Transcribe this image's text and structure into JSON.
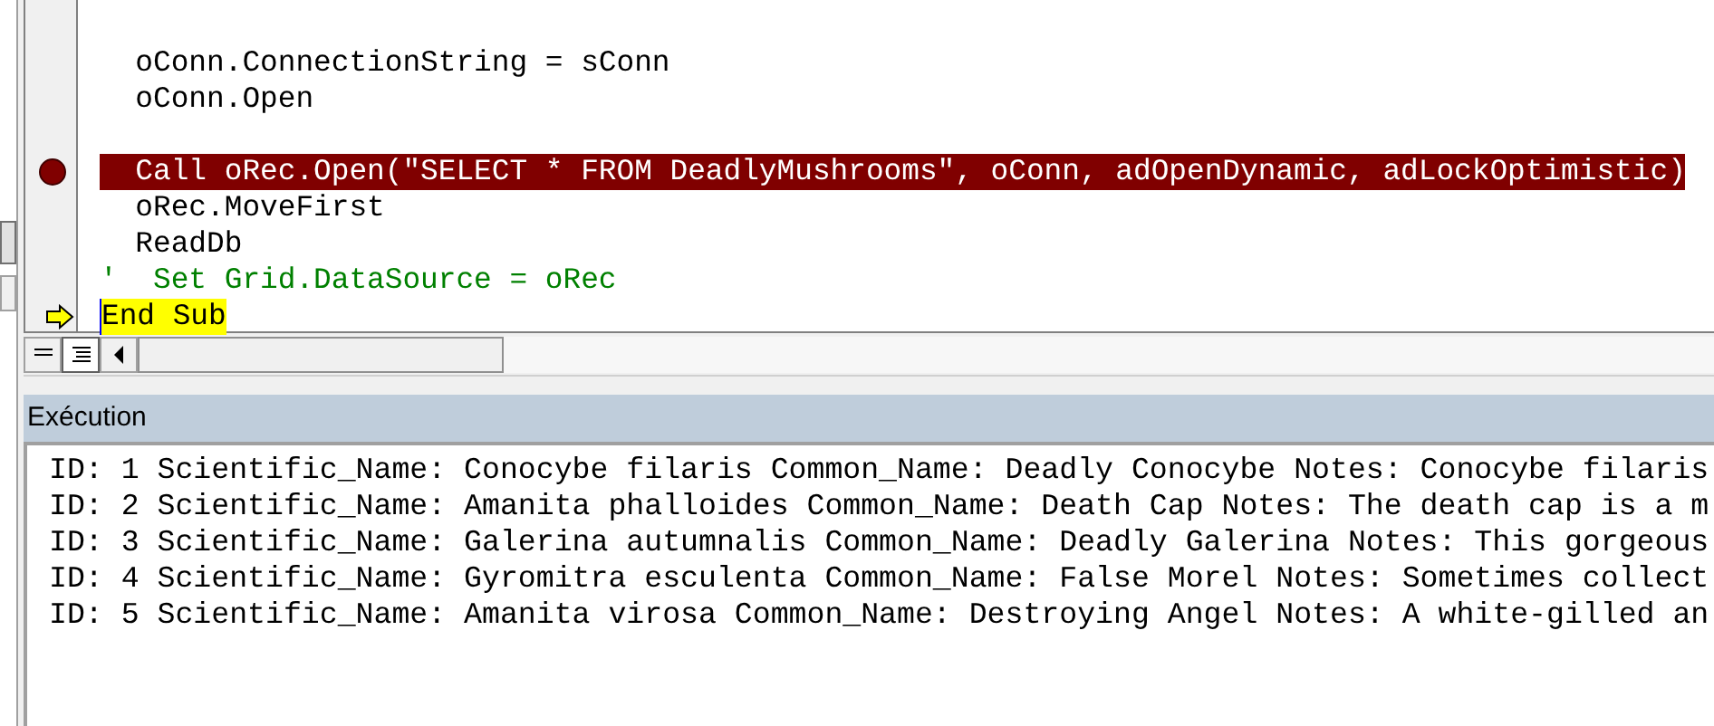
{
  "code_lines": [
    {
      "kind": "blank"
    },
    {
      "kind": "code",
      "text": "  oConn.ConnectionString = sConn",
      "breakpoint": false,
      "current": false
    },
    {
      "kind": "code",
      "text": "  oConn.Open",
      "breakpoint": false,
      "current": false
    },
    {
      "kind": "blank"
    },
    {
      "kind": "code",
      "text": "  Call oRec.Open(\"SELECT * FROM DeadlyMushrooms\", oConn, adOpenDynamic, adLockOptimistic)",
      "breakpoint": true,
      "current": false
    },
    {
      "kind": "code",
      "text": "  oRec.MoveFirst",
      "breakpoint": false,
      "current": false
    },
    {
      "kind": "code",
      "text": "  ReadDb",
      "breakpoint": false,
      "current": false
    },
    {
      "kind": "comment",
      "text": "'  Set Grid.DataSource = oRec",
      "breakpoint": false,
      "current": false
    },
    {
      "kind": "code",
      "text": "End Sub",
      "breakpoint": false,
      "current": true
    }
  ],
  "view_buttons": [
    {
      "kind": "procedure",
      "selected": false
    },
    {
      "kind": "module",
      "selected": true
    }
  ],
  "immediate": {
    "title": "Exécution",
    "lines": [
      "ID: 1 Scientific_Name: Conocybe filaris Common_Name: Deadly Conocybe Notes: Conocybe filaris",
      "ID: 2 Scientific_Name: Amanita phalloides Common_Name: Death Cap Notes: The death cap is a m",
      "ID: 3 Scientific_Name: Galerina autumnalis Common_Name: Deadly Galerina Notes: This gorgeous",
      "ID: 4 Scientific_Name: Gyromitra esculenta Common_Name: False Morel Notes: Sometimes collect",
      "ID: 5 Scientific_Name: Amanita virosa Common_Name: Destroying Angel Notes: A white-gilled an"
    ]
  }
}
